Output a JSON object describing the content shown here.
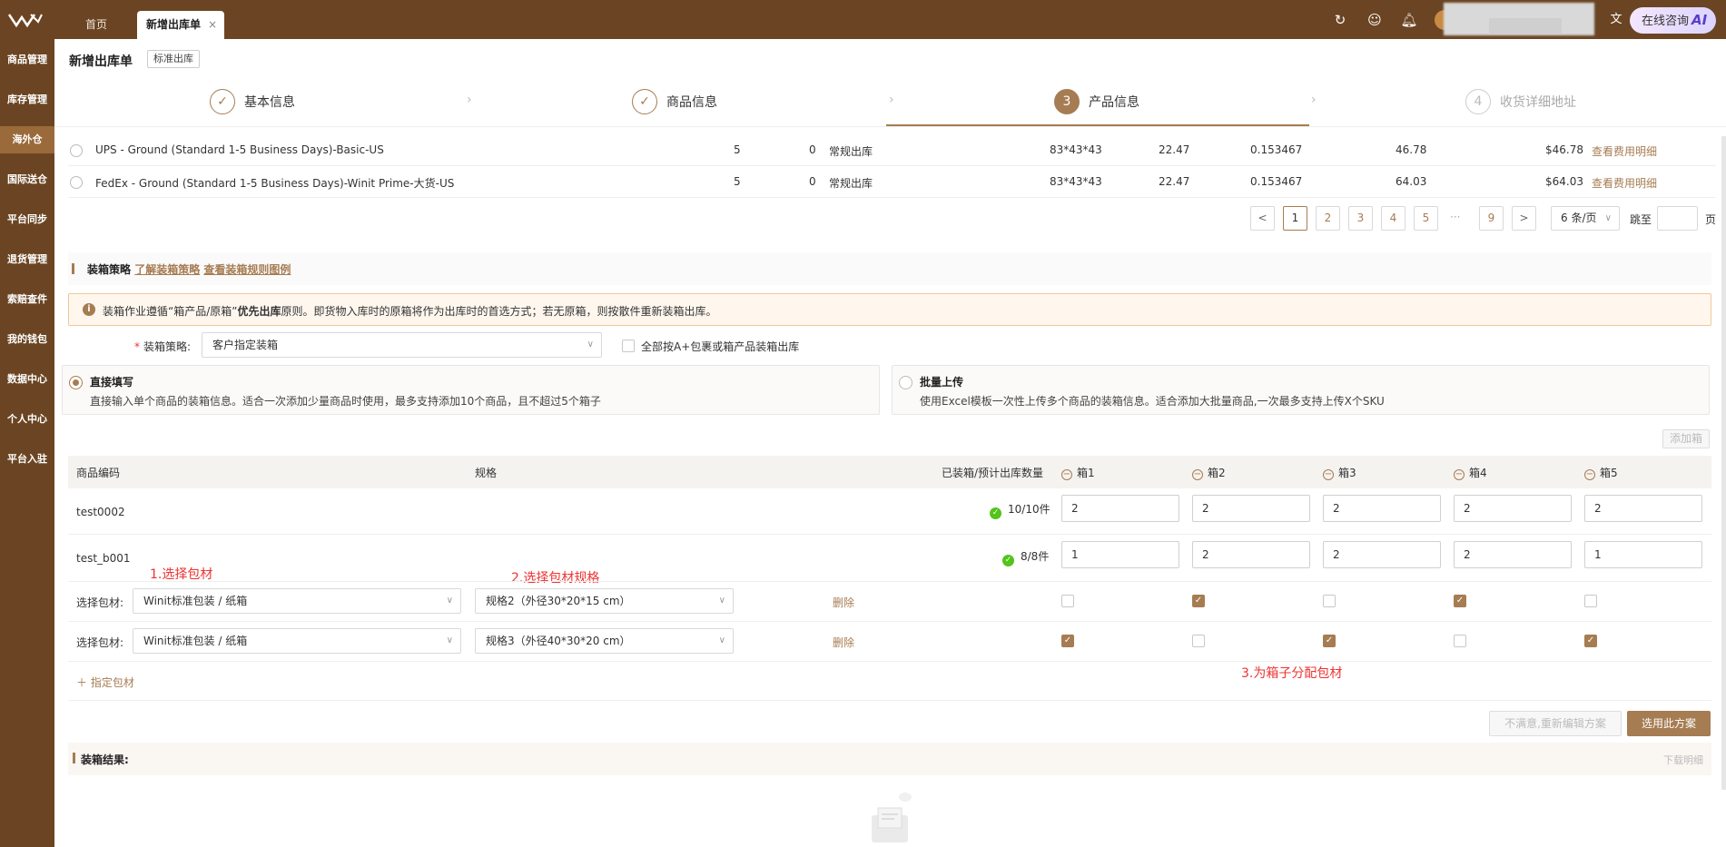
{
  "topbar": {
    "tabs": [
      {
        "label": "首页"
      },
      {
        "label": "新增出库单"
      }
    ],
    "close_glyph": "×",
    "icons": [
      "refresh-icon",
      "smile-icon",
      "bell-icon",
      "language-icon"
    ],
    "ai_button": {
      "label": "在线咨询",
      "badge": "AI"
    }
  },
  "sidebar": {
    "items": [
      {
        "label": "商品管理"
      },
      {
        "label": "库存管理"
      },
      {
        "label": "海外仓"
      },
      {
        "label": "国际送仓"
      },
      {
        "label": "平台同步"
      },
      {
        "label": "退货管理"
      },
      {
        "label": "索赔查件"
      },
      {
        "label": "我的钱包"
      },
      {
        "label": "数据中心"
      },
      {
        "label": "个人中心"
      },
      {
        "label": "平台入驻"
      }
    ],
    "active_index": 2
  },
  "page": {
    "title": "新增出库单",
    "type_tag": "标准出库"
  },
  "steps": [
    {
      "num": "✓",
      "label": "基本信息",
      "state": "done"
    },
    {
      "num": "✓",
      "label": "商品信息",
      "state": "done"
    },
    {
      "num": "3",
      "label": "产品信息",
      "state": "current"
    },
    {
      "num": "4",
      "label": "收货详细地址",
      "state": "todo"
    }
  ],
  "shipping": {
    "rows": [
      {
        "name": "UPS - Ground (Standard 1-5 Business Days)-Basic-US",
        "c1": "5",
        "c2": "0",
        "type": "常规出库",
        "dims": "83*43*43",
        "weight": "22.47",
        "volume": "0.153467",
        "fee": "46.78",
        "total": "$46.78",
        "link": "查看费用明细"
      },
      {
        "name": "FedEx - Ground (Standard 1-5 Business Days)-Winit Prime-大货-US",
        "c1": "5",
        "c2": "0",
        "type": "常规出库",
        "dims": "83*43*43",
        "weight": "22.47",
        "volume": "0.153467",
        "fee": "64.03",
        "total": "$64.03",
        "link": "查看费用明细"
      }
    ],
    "pager": {
      "prev": "<",
      "next": ">",
      "pages": [
        "1",
        "2",
        "3",
        "4",
        "5"
      ],
      "ellipsis": "···",
      "last": "9",
      "current": "1",
      "size_label": "6 条/页",
      "jump_label": "跳至",
      "unit": "页"
    }
  },
  "packing": {
    "section_title": "装箱策略",
    "link_learn": "了解装箱策略",
    "link_rules": "查看装箱规则图例",
    "notice": {
      "pre": "装箱作业遵循“箱产品/原箱”",
      "bold": "优先出库",
      "post": "原则。即货物入库时的原箱将作为出库时的首选方式；若无原箱，则按散件重新装箱出库。"
    },
    "strategy_label": "装箱策略:",
    "strategy_value": "客户指定装箱",
    "checkbox_all": "全部按A+包裹或箱产品装箱出库",
    "option_direct": {
      "title": "直接填写",
      "desc": "直接输入单个商品的装箱信息。适合一次添加少量商品时使用，最多支持添加10个商品，且不超过5个箱子"
    },
    "option_batch": {
      "title": "批量上传",
      "desc": "使用Excel模板一次性上传多个商品的装箱信息。适合添加大批量商品,一次最多支持上传X个SKU"
    },
    "add_box": "添加箱",
    "table": {
      "col_sku": "商品编码",
      "col_spec": "规格",
      "col_qty": "已装箱/预计出库数量",
      "boxes": [
        "箱1",
        "箱2",
        "箱3",
        "箱4",
        "箱5"
      ],
      "rows": [
        {
          "sku": "test0002",
          "qty": "10/10件",
          "values": [
            "2",
            "2",
            "2",
            "2",
            "2"
          ]
        },
        {
          "sku": "test_b001",
          "qty": "8/8件",
          "values": [
            "1",
            "2",
            "2",
            "2",
            "1"
          ]
        }
      ],
      "material_rows": [
        {
          "label": "选择包材:",
          "material": "Winit标准包装 / 纸箱",
          "spec": "规格2（外径30*20*15 cm）",
          "delete": "删除",
          "checks": [
            false,
            true,
            false,
            true,
            false
          ]
        },
        {
          "label": "选择包材:",
          "material": "Winit标准包装 / 纸箱",
          "spec": "规格3（外径40*30*20 cm）",
          "delete": "删除",
          "checks": [
            true,
            false,
            true,
            false,
            true
          ]
        }
      ],
      "add_material": "指定包材"
    },
    "annotations": [
      "1.选择包材",
      "2.选择包材规格",
      "3.为箱子分配包材"
    ],
    "btn_reedit": "不满意,重新编辑方案",
    "btn_use": "选用此方案",
    "result_title": "装箱结果:",
    "result_download": "下载明细"
  },
  "colors": {
    "brand": "#6b4523",
    "accent": "#a67c52",
    "annotation": "#e33333",
    "success": "#52c41a"
  }
}
